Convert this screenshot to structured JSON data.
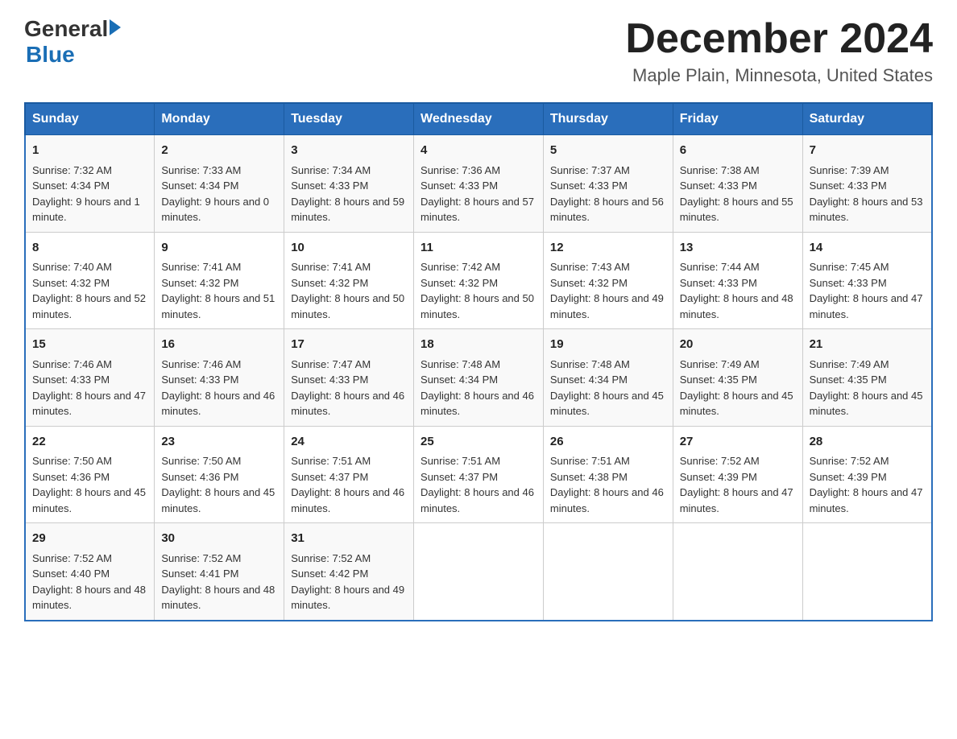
{
  "logo": {
    "text_general": "General",
    "arrow": "▶",
    "text_blue": "Blue"
  },
  "header": {
    "month_year": "December 2024",
    "location": "Maple Plain, Minnesota, United States"
  },
  "days_of_week": [
    "Sunday",
    "Monday",
    "Tuesday",
    "Wednesday",
    "Thursday",
    "Friday",
    "Saturday"
  ],
  "weeks": [
    [
      {
        "day": "1",
        "sunrise": "Sunrise: 7:32 AM",
        "sunset": "Sunset: 4:34 PM",
        "daylight": "Daylight: 9 hours and 1 minute."
      },
      {
        "day": "2",
        "sunrise": "Sunrise: 7:33 AM",
        "sunset": "Sunset: 4:34 PM",
        "daylight": "Daylight: 9 hours and 0 minutes."
      },
      {
        "day": "3",
        "sunrise": "Sunrise: 7:34 AM",
        "sunset": "Sunset: 4:33 PM",
        "daylight": "Daylight: 8 hours and 59 minutes."
      },
      {
        "day": "4",
        "sunrise": "Sunrise: 7:36 AM",
        "sunset": "Sunset: 4:33 PM",
        "daylight": "Daylight: 8 hours and 57 minutes."
      },
      {
        "day": "5",
        "sunrise": "Sunrise: 7:37 AM",
        "sunset": "Sunset: 4:33 PM",
        "daylight": "Daylight: 8 hours and 56 minutes."
      },
      {
        "day": "6",
        "sunrise": "Sunrise: 7:38 AM",
        "sunset": "Sunset: 4:33 PM",
        "daylight": "Daylight: 8 hours and 55 minutes."
      },
      {
        "day": "7",
        "sunrise": "Sunrise: 7:39 AM",
        "sunset": "Sunset: 4:33 PM",
        "daylight": "Daylight: 8 hours and 53 minutes."
      }
    ],
    [
      {
        "day": "8",
        "sunrise": "Sunrise: 7:40 AM",
        "sunset": "Sunset: 4:32 PM",
        "daylight": "Daylight: 8 hours and 52 minutes."
      },
      {
        "day": "9",
        "sunrise": "Sunrise: 7:41 AM",
        "sunset": "Sunset: 4:32 PM",
        "daylight": "Daylight: 8 hours and 51 minutes."
      },
      {
        "day": "10",
        "sunrise": "Sunrise: 7:41 AM",
        "sunset": "Sunset: 4:32 PM",
        "daylight": "Daylight: 8 hours and 50 minutes."
      },
      {
        "day": "11",
        "sunrise": "Sunrise: 7:42 AM",
        "sunset": "Sunset: 4:32 PM",
        "daylight": "Daylight: 8 hours and 50 minutes."
      },
      {
        "day": "12",
        "sunrise": "Sunrise: 7:43 AM",
        "sunset": "Sunset: 4:32 PM",
        "daylight": "Daylight: 8 hours and 49 minutes."
      },
      {
        "day": "13",
        "sunrise": "Sunrise: 7:44 AM",
        "sunset": "Sunset: 4:33 PM",
        "daylight": "Daylight: 8 hours and 48 minutes."
      },
      {
        "day": "14",
        "sunrise": "Sunrise: 7:45 AM",
        "sunset": "Sunset: 4:33 PM",
        "daylight": "Daylight: 8 hours and 47 minutes."
      }
    ],
    [
      {
        "day": "15",
        "sunrise": "Sunrise: 7:46 AM",
        "sunset": "Sunset: 4:33 PM",
        "daylight": "Daylight: 8 hours and 47 minutes."
      },
      {
        "day": "16",
        "sunrise": "Sunrise: 7:46 AM",
        "sunset": "Sunset: 4:33 PM",
        "daylight": "Daylight: 8 hours and 46 minutes."
      },
      {
        "day": "17",
        "sunrise": "Sunrise: 7:47 AM",
        "sunset": "Sunset: 4:33 PM",
        "daylight": "Daylight: 8 hours and 46 minutes."
      },
      {
        "day": "18",
        "sunrise": "Sunrise: 7:48 AM",
        "sunset": "Sunset: 4:34 PM",
        "daylight": "Daylight: 8 hours and 46 minutes."
      },
      {
        "day": "19",
        "sunrise": "Sunrise: 7:48 AM",
        "sunset": "Sunset: 4:34 PM",
        "daylight": "Daylight: 8 hours and 45 minutes."
      },
      {
        "day": "20",
        "sunrise": "Sunrise: 7:49 AM",
        "sunset": "Sunset: 4:35 PM",
        "daylight": "Daylight: 8 hours and 45 minutes."
      },
      {
        "day": "21",
        "sunrise": "Sunrise: 7:49 AM",
        "sunset": "Sunset: 4:35 PM",
        "daylight": "Daylight: 8 hours and 45 minutes."
      }
    ],
    [
      {
        "day": "22",
        "sunrise": "Sunrise: 7:50 AM",
        "sunset": "Sunset: 4:36 PM",
        "daylight": "Daylight: 8 hours and 45 minutes."
      },
      {
        "day": "23",
        "sunrise": "Sunrise: 7:50 AM",
        "sunset": "Sunset: 4:36 PM",
        "daylight": "Daylight: 8 hours and 45 minutes."
      },
      {
        "day": "24",
        "sunrise": "Sunrise: 7:51 AM",
        "sunset": "Sunset: 4:37 PM",
        "daylight": "Daylight: 8 hours and 46 minutes."
      },
      {
        "day": "25",
        "sunrise": "Sunrise: 7:51 AM",
        "sunset": "Sunset: 4:37 PM",
        "daylight": "Daylight: 8 hours and 46 minutes."
      },
      {
        "day": "26",
        "sunrise": "Sunrise: 7:51 AM",
        "sunset": "Sunset: 4:38 PM",
        "daylight": "Daylight: 8 hours and 46 minutes."
      },
      {
        "day": "27",
        "sunrise": "Sunrise: 7:52 AM",
        "sunset": "Sunset: 4:39 PM",
        "daylight": "Daylight: 8 hours and 47 minutes."
      },
      {
        "day": "28",
        "sunrise": "Sunrise: 7:52 AM",
        "sunset": "Sunset: 4:39 PM",
        "daylight": "Daylight: 8 hours and 47 minutes."
      }
    ],
    [
      {
        "day": "29",
        "sunrise": "Sunrise: 7:52 AM",
        "sunset": "Sunset: 4:40 PM",
        "daylight": "Daylight: 8 hours and 48 minutes."
      },
      {
        "day": "30",
        "sunrise": "Sunrise: 7:52 AM",
        "sunset": "Sunset: 4:41 PM",
        "daylight": "Daylight: 8 hours and 48 minutes."
      },
      {
        "day": "31",
        "sunrise": "Sunrise: 7:52 AM",
        "sunset": "Sunset: 4:42 PM",
        "daylight": "Daylight: 8 hours and 49 minutes."
      },
      null,
      null,
      null,
      null
    ]
  ]
}
